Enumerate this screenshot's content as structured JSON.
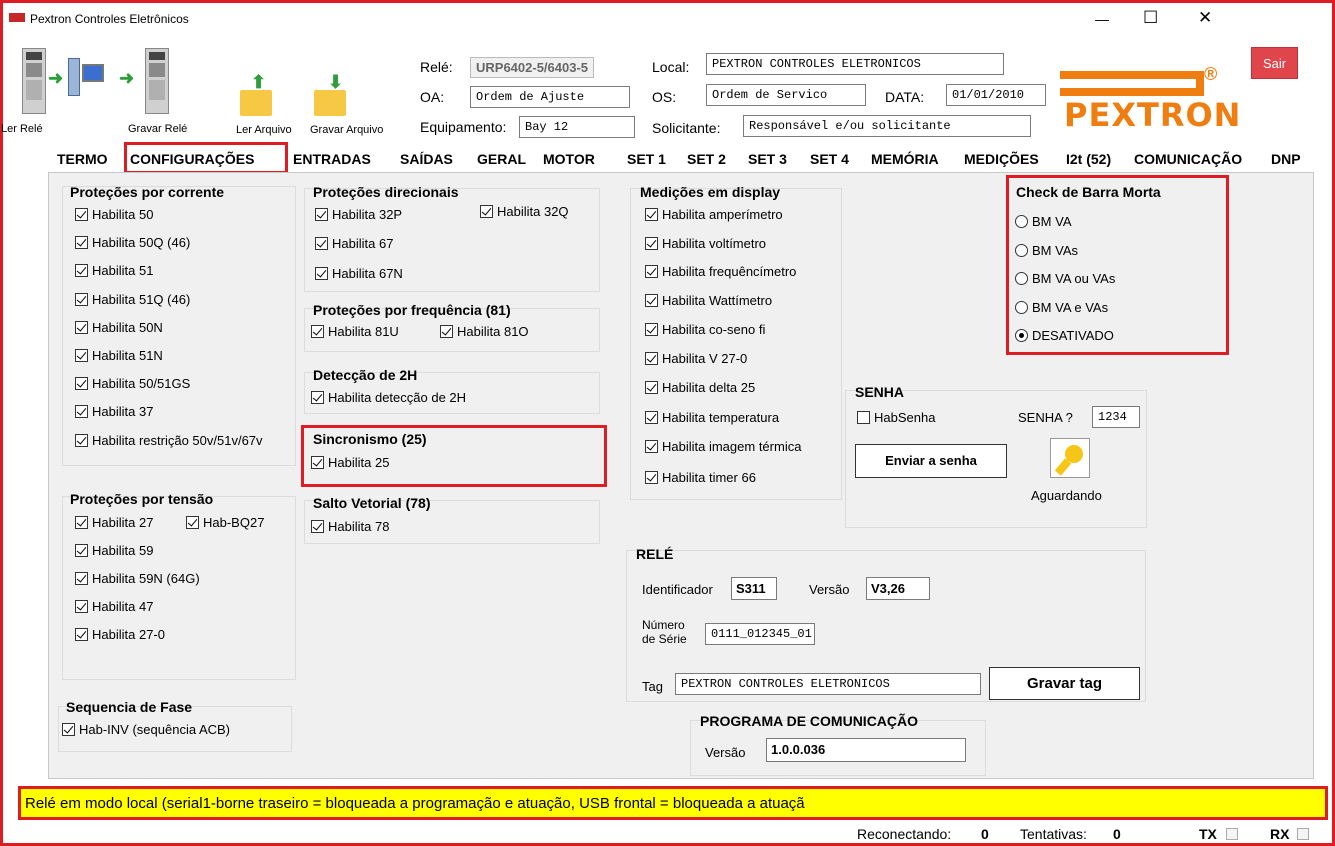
{
  "window": {
    "title": "Pextron Controles Eletrônicos",
    "min_glyph": "—",
    "max_glyph": "☐",
    "close_glyph": "✕"
  },
  "toolbar": {
    "ler_rele": "Ler Relé",
    "gravar_rele": "Gravar Relé",
    "ler_arquivo": "Ler Arquivo",
    "gravar_arquivo": "Gravar Arquivo"
  },
  "header": {
    "rele_label": "Relé:",
    "rele_value": "URP6402-5/6403-5",
    "oa_label": "OA:",
    "oa_value": "Ordem de Ajuste",
    "equip_label": "Equipamento:",
    "equip_value": "Bay 12",
    "local_label": "Local:",
    "local_value": "PEXTRON CONTROLES ELETRONICOS",
    "os_label": "OS:",
    "os_value": "Ordem de Servico",
    "data_label": "DATA:",
    "data_value": "01/01/2010",
    "solicitante_label": "Solicitante:",
    "solicitante_value": "Responsável e/ou solicitante",
    "sair": "Sair",
    "logo_text": "PEXTRON",
    "logo_reg": "®"
  },
  "tabs": [
    "TERMO",
    "CONFIGURAÇÕES",
    "ENTRADAS",
    "SAÍDAS",
    "GERAL",
    "MOTOR",
    "SET 1",
    "SET 2",
    "SET 3",
    "SET 4",
    "MEMÓRIA",
    "MEDIÇÕES",
    "I2t (52)",
    "COMUNICAÇÃO",
    "DNP"
  ],
  "prot_corrente": {
    "title": "Proteções por corrente",
    "items": [
      "Habilita 50",
      "Habilita 50Q (46)",
      "Habilita 51",
      "Habilita 51Q (46)",
      "Habilita 50N",
      "Habilita 51N",
      "Habilita 50/51GS",
      "Habilita 37",
      "Habilita restrição 50v/51v/67v"
    ]
  },
  "prot_tensao": {
    "title": "Proteções por tensão",
    "items": [
      "Habilita 27",
      "Hab-BQ27",
      "Habilita 59",
      "Habilita 59N (64G)",
      "Habilita 47",
      "Habilita 27-0"
    ]
  },
  "seq_fase": {
    "title": "Sequencia de Fase",
    "item": "Hab-INV (sequência ACB)"
  },
  "prot_direcionais": {
    "title": "Proteções direcionais",
    "items": [
      "Habilita 32P",
      "Habilita 32Q",
      "Habilita 67",
      "Habilita 67N"
    ]
  },
  "prot_frequencia": {
    "title": "Proteções por frequência (81)",
    "items": [
      "Habilita 81U",
      "Habilita 81O"
    ]
  },
  "det_2h": {
    "title": "Detecção de 2H",
    "item": "Habilita detecção de 2H"
  },
  "sincronismo": {
    "title": "Sincronismo (25)",
    "item": "Habilita 25"
  },
  "salto": {
    "title": "Salto Vetorial (78)",
    "item": "Habilita 78"
  },
  "medicoes": {
    "title": "Medições em display",
    "items": [
      "Habilita amperímetro",
      "Habilita voltímetro",
      "Habilita frequêncímetro",
      "Habilita Wattímetro",
      "Habilita co-seno fi",
      "Habilita V 27-0",
      "Habilita delta 25",
      "Habilita temperatura",
      "Habilita imagem térmica",
      "Habilita timer 66"
    ]
  },
  "barra_morta": {
    "title": "Check de Barra Morta",
    "options": [
      "BM VA",
      "BM VAs",
      "BM VA ou VAs",
      "BM VA e VAs",
      "DESATIVADO"
    ],
    "selected": "DESATIVADO"
  },
  "senha": {
    "title": "SENHA",
    "hab": "HabSenha",
    "label": "SENHA ?",
    "value": "1234",
    "enviar": "Enviar a senha",
    "status": "Aguardando"
  },
  "rele": {
    "title": "RELÉ",
    "ident_label": "Identificador",
    "ident_value": "S311",
    "versao_label": "Versão",
    "versao_value": "V3,26",
    "numero_label_1": "Número",
    "numero_label_2": "de Série",
    "numero_value": "0111_012345_01",
    "tag_label": "Tag",
    "tag_value": "PEXTRON CONTROLES ELETRONICOS",
    "gravar_tag": "Gravar tag"
  },
  "programa": {
    "title": "PROGRAMA DE COMUNICAÇÃO",
    "versao_label": "Versão",
    "versao_value": "1.0.0.036"
  },
  "status_bar": {
    "message": "Relé em modo local (serial1-borne traseiro = bloqueada a programação e atuação, USB frontal = bloqueada a atuaçã",
    "reconectando_label": "Reconectando:",
    "reconectando_value": "0",
    "tentativas_label": "Tentativas:",
    "tentativas_value": "0",
    "tx": "TX",
    "rx": "RX"
  },
  "colors": {
    "highlight_border": "#dd1c24",
    "logo_orange": "#ef7d0f",
    "status_yellow": "#ffff00",
    "sair_red": "#e0454b",
    "panel_gray": "#f0f0f0"
  }
}
